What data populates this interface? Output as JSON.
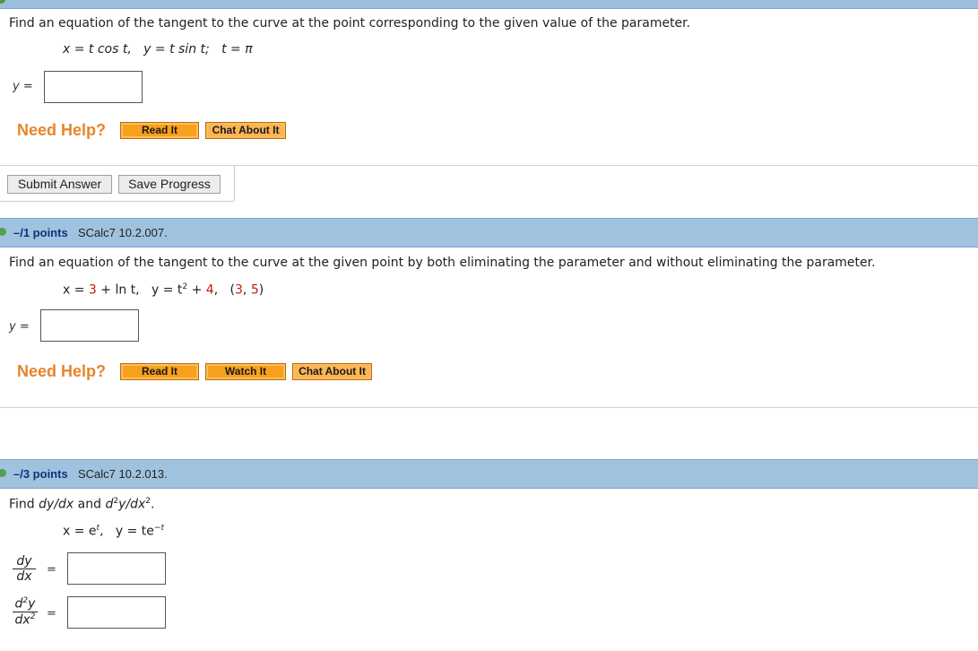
{
  "q1": {
    "prompt": "Find an equation of the tangent to the curve at the point corresponding to the given value of the parameter.",
    "eq_x": "x = t cos t,",
    "eq_y": "y = t sin t;",
    "eq_t": "t = π",
    "answer_label": "y =",
    "answer_value": "",
    "need_help": "Need Help?",
    "buttons": [
      "Read It",
      "Chat About It"
    ]
  },
  "actions": {
    "submit": "Submit Answer",
    "save": "Save Progress"
  },
  "q2": {
    "points": "–/1 points",
    "source": "SCalc7 10.2.007.",
    "prompt": "Find an equation of the tangent to the curve at the given point by both eliminating the parameter and without eliminating the parameter.",
    "eq_x_pre": "x = ",
    "eq_x_num": "3",
    "eq_x_post": " + ln t,",
    "eq_y_pre": "y = t",
    "eq_y_exp": "2",
    "eq_y_plus": " + ",
    "eq_y_num": "4",
    "eq_y_post": ",",
    "pt_open": "(",
    "pt_x": "3",
    "pt_sep": ", ",
    "pt_y": "5",
    "pt_close": ")",
    "answer_label": "y =",
    "answer_value": "",
    "need_help": "Need Help?",
    "buttons": [
      "Read It",
      "Watch It",
      "Chat About It"
    ]
  },
  "q3": {
    "points": "–/3 points",
    "source": "SCalc7 10.2.013.",
    "prompt_pre": "Find ",
    "prompt_a": "dy/dx",
    "prompt_mid": " and ",
    "prompt_b1": "d",
    "prompt_b_exp1": "2",
    "prompt_b2": "y/dx",
    "prompt_b_exp2": "2",
    "prompt_end": ".",
    "eq_x_pre": "x = e",
    "eq_x_exp": "t",
    "eq_x_post": ",",
    "eq_y_pre": "y = te",
    "eq_y_exp": "−t",
    "frac1_num": "dy",
    "frac1_den": "dx",
    "frac2_num_a": "d",
    "frac2_num_exp": "2",
    "frac2_num_b": "y",
    "frac2_den_a": "dx",
    "frac2_den_exp": "2",
    "equals": "=",
    "answer1_value": "",
    "answer2_value": ""
  }
}
